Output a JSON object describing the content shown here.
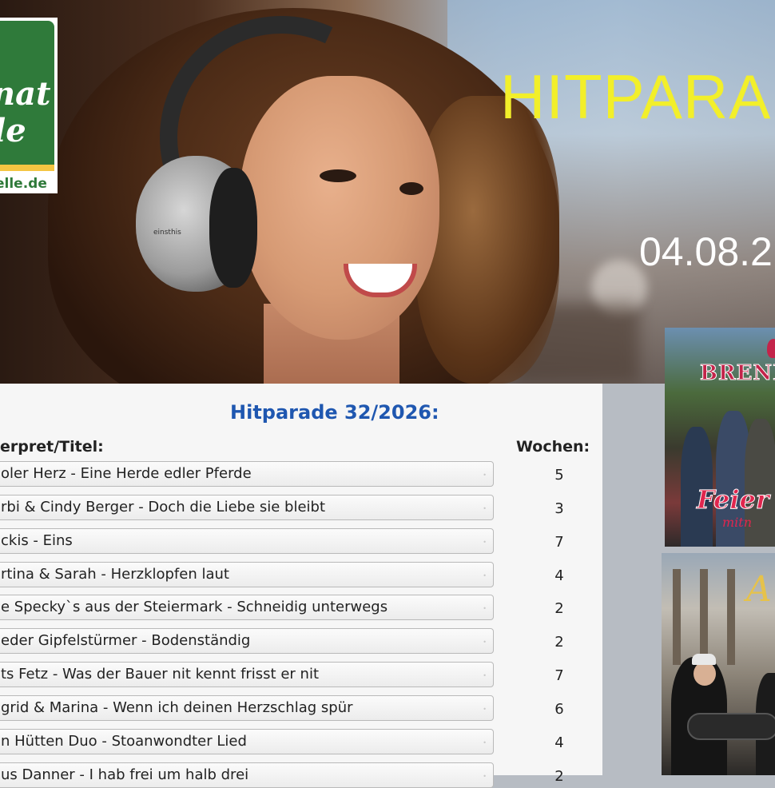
{
  "logo": {
    "line1": "nat",
    "line2": "le",
    "url": "elle.de"
  },
  "hero": {
    "title": "HITPARA",
    "date": "04.08.2",
    "headphone_brand": "einsthis"
  },
  "chart": {
    "heading": "Hitparade 32/2026:",
    "col_artist": "erpret/Titel:",
    "col_weeks": "Wochen:",
    "rows": [
      {
        "title": "oler Herz - Eine Herde edler Pferde",
        "weeks": "5"
      },
      {
        "title": "rbi & Cindy Berger - Doch die Liebe sie bleibt",
        "weeks": "3"
      },
      {
        "title": "ckis - Eins",
        "weeks": "7"
      },
      {
        "title": "rtina & Sarah - Herzklopfen laut",
        "weeks": "4"
      },
      {
        "title": "e Specky`s aus der Steiermark - Schneidig unterwegs",
        "weeks": "2"
      },
      {
        "title": "eder Gipfelstürmer - Bodenständig",
        "weeks": "2"
      },
      {
        "title": "ts Fetz - Was der Bauer nit kennt frisst er nit",
        "weeks": "7"
      },
      {
        "title": "grid & Marina - Wenn ich deinen Herzschlag spür",
        "weeks": "6"
      },
      {
        "title": "n Hütten Duo - Stoanwondter Lied",
        "weeks": "4"
      },
      {
        "title": "us Danner - I hab frei um halb drei",
        "weeks": "2"
      }
    ]
  },
  "albums": [
    {
      "brand": "BRENN",
      "script": "Feier",
      "script2": "mitn"
    },
    {
      "letter": "A"
    }
  ],
  "colors": {
    "title_yellow": "#f2ef2a",
    "heading_blue": "#1f57b0",
    "logo_green": "#2f7a3a"
  }
}
